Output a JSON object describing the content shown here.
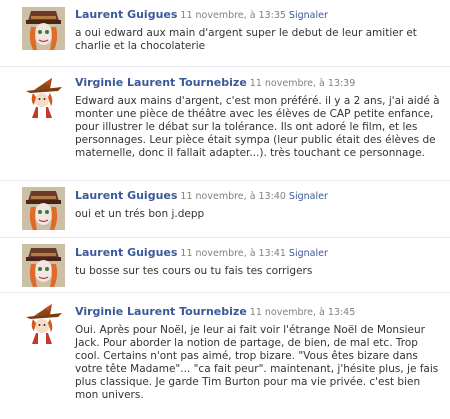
{
  "comments": [
    {
      "author": "Laurent Guigues",
      "timestamp": "11 novembre, à 13:35",
      "report_label": "Signaler",
      "avatar": "johnny-depp-mad-hatter",
      "text": "a oui edward aux main d'argent super le debut de leur amitier et charlie et la chocolaterie"
    },
    {
      "author": "Virginie Laurent Tournebize",
      "timestamp": "11 novembre, à 13:39",
      "report_label": "",
      "avatar": "witch-girl-illustration",
      "text": "Edward aux mains d'argent, c'est mon préféré. il y a 2 ans, j'ai aidé à monter une pièce de théâtre avec les élèves de CAP petite enfance, pour illustrer le débat sur la tolérance. Ils ont adoré le film, et les personnages. Leur pièce était sympa (leur public était des élèves de maternelle, donc il fallait adapter...). très touchant ce personnage."
    },
    {
      "author": "Laurent Guigues",
      "timestamp": "11 novembre, à 13:40",
      "report_label": "Signaler",
      "avatar": "johnny-depp-mad-hatter",
      "text": "oui et un trés bon j.depp"
    },
    {
      "author": "Laurent Guigues",
      "timestamp": "11 novembre, à 13:41",
      "report_label": "Signaler",
      "avatar": "johnny-depp-mad-hatter",
      "text": "tu bosse sur tes cours ou tu fais tes corrigers"
    },
    {
      "author": "Virginie Laurent Tournebize",
      "timestamp": "11 novembre, à 13:45",
      "report_label": "",
      "avatar": "witch-girl-illustration",
      "text": "Oui. Après pour Noël, je leur ai fait voir l'étrange Noël de Monsieur Jack. Pour aborder la notion de partage, de bien, de mal etc. Trop cool. Certains n'ont pas aimé, trop bizare. \"Vous êtes bizare dans votre tête Madame\"... \"ca fait peur\". maintenant, j'hésite plus, je fais plus classique. Je garde Tim Burton pour ma vie privée. c'est bien mon univers."
    }
  ]
}
